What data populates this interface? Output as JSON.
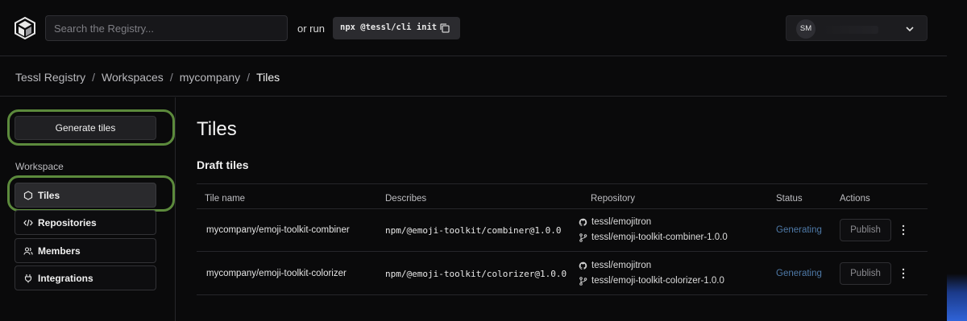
{
  "header": {
    "search_placeholder": "Search the Registry...",
    "or_run": "or run",
    "cli_command": "npx @tessl/cli init",
    "user_initials": "SM"
  },
  "breadcrumb": [
    "Tessl Registry",
    "Workspaces",
    "mycompany",
    "Tiles"
  ],
  "sidebar": {
    "generate_label": "Generate tiles",
    "section_label": "Workspace",
    "items": [
      {
        "label": "Tiles",
        "icon": "hexagon-icon",
        "active": true
      },
      {
        "label": "Repositories",
        "icon": "code-icon"
      },
      {
        "label": "Members",
        "icon": "users-icon"
      },
      {
        "label": "Integrations",
        "icon": "plug-icon"
      }
    ]
  },
  "main": {
    "title": "Tiles",
    "section_title": "Draft tiles",
    "columns": [
      "Tile name",
      "Describes",
      "Repository",
      "Status",
      "Actions"
    ],
    "rows": [
      {
        "name": "mycompany/emoji-toolkit-combiner",
        "describes": "npm/@emoji-toolkit/combiner@1.0.0",
        "repo": "tessl/emojitron",
        "branch": "tessl/emoji-toolkit-combiner-1.0.0",
        "status": "Generating",
        "action": "Publish"
      },
      {
        "name": "mycompany/emoji-toolkit-colorizer",
        "describes": "npm/@emoji-toolkit/colorizer@1.0.0",
        "repo": "tessl/emojitron",
        "branch": "tessl/emoji-toolkit-colorizer-1.0.0",
        "status": "Generating",
        "action": "Publish"
      }
    ]
  },
  "colors": {
    "status_generating": "#4e79a7",
    "highlight_ring": "#5c8a3c"
  }
}
